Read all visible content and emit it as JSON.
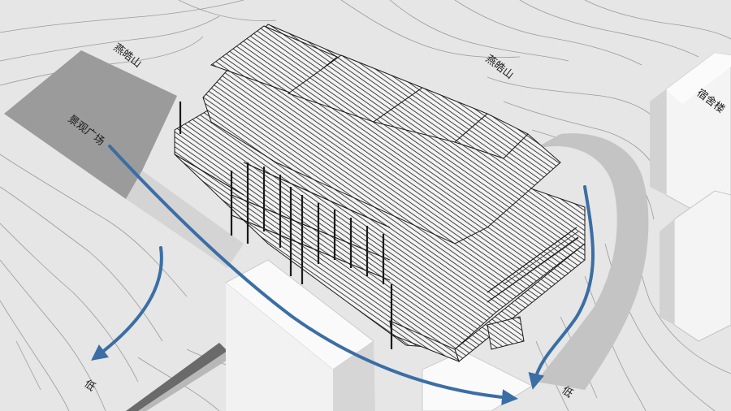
{
  "labels": {
    "hill_left": "燕皓山",
    "hill_right": "燕皓山",
    "plaza": "景观广场",
    "dorm": "宿舍楼",
    "low_left": "低",
    "low_right": "低"
  },
  "colors": {
    "background": "#e6e6e6",
    "contour": "#9a9a9a",
    "plaza": "#9b9b9b",
    "road": "#c4c4c4",
    "building_face": "#f4f4f4",
    "building_side": "#d2d2d2",
    "hatch": "#222222",
    "flow_arrow": "#3a6ea5"
  },
  "icons": {
    "flow": "arrow-icon"
  }
}
